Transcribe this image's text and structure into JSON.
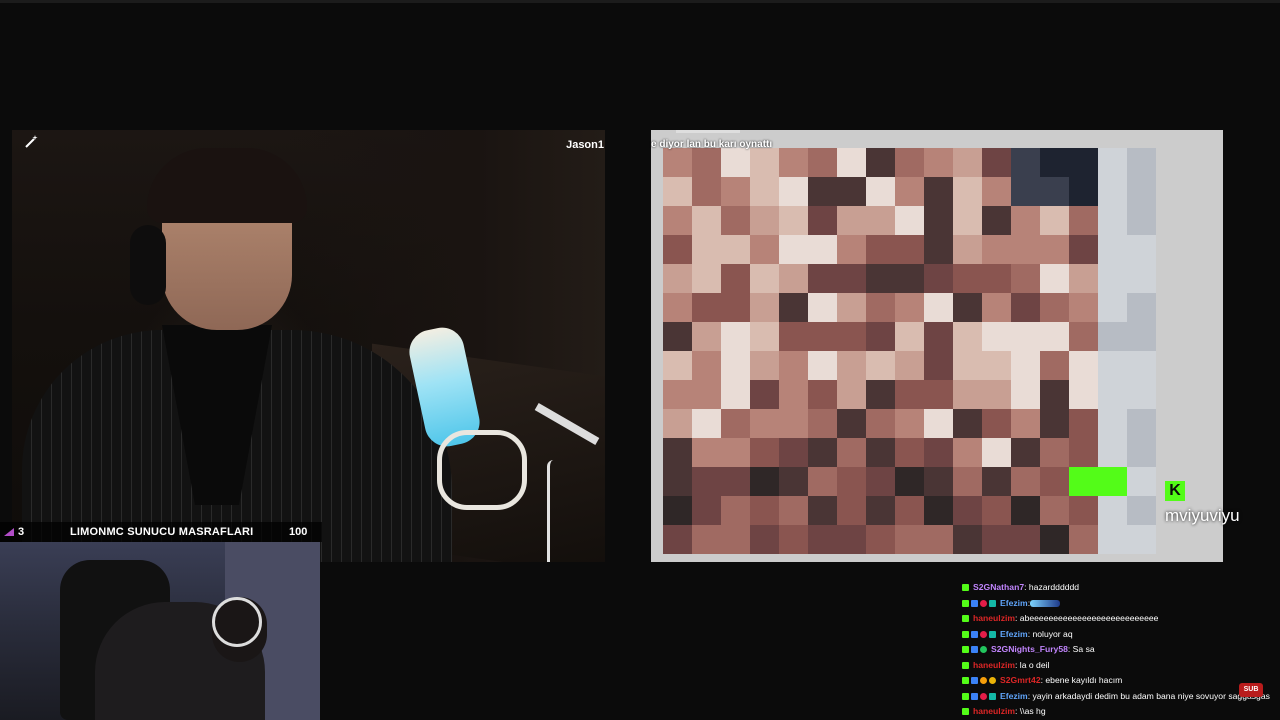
{
  "left_camera": {
    "name_tag": "Jason1",
    "wand_icon": "magic-wand-icon"
  },
  "goal_bar": {
    "count": "3",
    "label": "LIMONMC SUNUCU MASRAFLARI",
    "value": "100"
  },
  "right_camera": {
    "caption": "e diyor lan bu karı oynattı",
    "overlay_username": "mviyuviyu",
    "kick_logo_text": "K"
  },
  "chat": {
    "messages": [
      {
        "username": "S2GNathan7",
        "color": "#c084fc",
        "text": " : hazardddddd"
      },
      {
        "username": "Efezim",
        "color": "#60a5fa",
        "text": " : "
      },
      {
        "username": "haneulzim",
        "color": "#dc2626",
        "text": " : abeeeeeeeeeeeeeeeeeeeeeeeeeee"
      },
      {
        "username": "Efezim",
        "color": "#60a5fa",
        "text": " : noluyor aq"
      },
      {
        "username": "S2GNights_Fury58",
        "color": "#c084fc",
        "text": " : Sa sa"
      },
      {
        "username": "haneulzim",
        "color": "#dc2626",
        "text": " : la o deil"
      },
      {
        "username": "S2Gmrt42",
        "color": "#dc2626",
        "text": " : ebene kayıldı hacım"
      },
      {
        "username": "Efezim",
        "color": "#60a5fa",
        "text": " : yayin arkadaydi dedim bu adam bana niye sovuyor saggasgas"
      },
      {
        "username": "haneulzim",
        "color": "#dc2626",
        "text": " : \\\\as hg"
      }
    ],
    "sub_badge_text": "SUB"
  },
  "colors": {
    "kick_green": "#53fc18",
    "background": "#0b0b0b"
  }
}
